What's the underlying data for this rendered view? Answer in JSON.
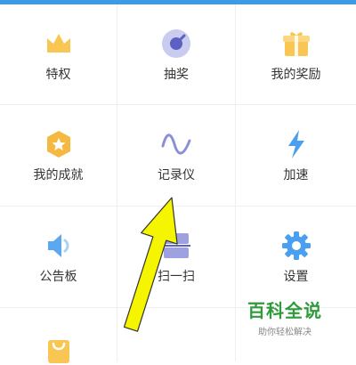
{
  "grid": {
    "items": [
      {
        "label": "特权",
        "icon": "crown-icon"
      },
      {
        "label": "抽奖",
        "icon": "lottery-icon"
      },
      {
        "label": "我的奖励",
        "icon": "gift-icon"
      },
      {
        "label": "我的成就",
        "icon": "achievement-icon"
      },
      {
        "label": "记录仪",
        "icon": "wave-icon"
      },
      {
        "label": "加速",
        "icon": "lightning-icon"
      },
      {
        "label": "公告板",
        "icon": "speaker-icon"
      },
      {
        "label": "扫一扫",
        "icon": "scan-icon"
      },
      {
        "label": "设置",
        "icon": "gear-icon"
      },
      {
        "label": "",
        "icon": "bag-icon"
      }
    ]
  },
  "watermark": {
    "title": "百科全说",
    "subtitle": "助你轻松解决"
  },
  "colors": {
    "accent_blue": "#3b9be6",
    "icon_yellow": "#f9c653",
    "icon_purple": "#8b8fd8",
    "arrow_yellow": "#f5f500",
    "watermark_green": "#2e9a3b"
  }
}
